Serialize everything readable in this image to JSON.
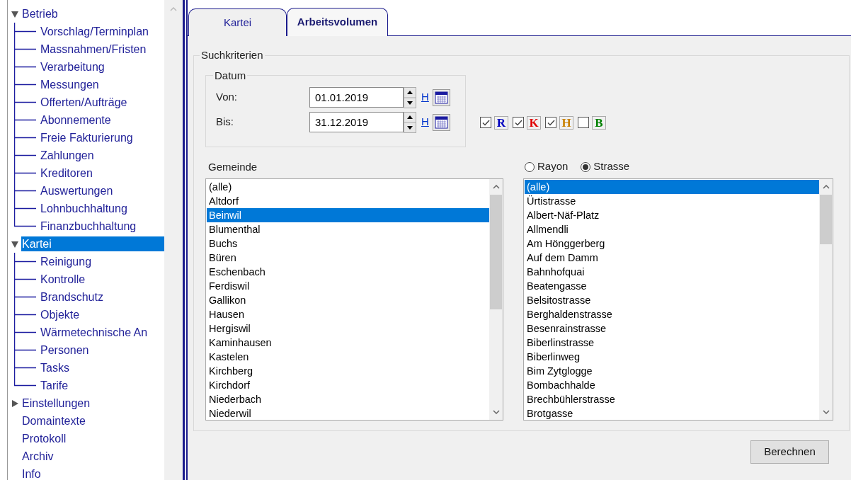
{
  "tree": [
    {
      "label": "Betrieb",
      "expanded": true,
      "selected": false,
      "children": [
        {
          "label": "Vorschlag/Terminplan",
          "selected": false
        },
        {
          "label": "Massnahmen/Fristen",
          "selected": false
        },
        {
          "label": "Verarbeitung",
          "selected": false
        },
        {
          "label": "Messungen",
          "selected": false
        },
        {
          "label": "Offerten/Aufträge",
          "selected": false
        },
        {
          "label": "Abonnemente",
          "selected": false
        },
        {
          "label": "Freie Fakturierung",
          "selected": false
        },
        {
          "label": "Zahlungen",
          "selected": false
        },
        {
          "label": "Kreditoren",
          "selected": false
        },
        {
          "label": "Auswertungen",
          "selected": false
        },
        {
          "label": "Lohnbuchhaltung",
          "selected": false
        },
        {
          "label": "Finanzbuchhaltung",
          "selected": false
        }
      ]
    },
    {
      "label": "Kartei",
      "expanded": true,
      "selected": true,
      "children": [
        {
          "label": "Reinigung",
          "selected": false
        },
        {
          "label": "Kontrolle",
          "selected": false
        },
        {
          "label": "Brandschutz",
          "selected": false
        },
        {
          "label": "Objekte",
          "selected": false
        },
        {
          "label": "Wärmetechnische An",
          "selected": false
        },
        {
          "label": "Personen",
          "selected": false
        },
        {
          "label": "Tasks",
          "selected": false
        },
        {
          "label": "Tarife",
          "selected": false
        }
      ]
    },
    {
      "label": "Einstellungen",
      "expanded": false,
      "selected": false
    },
    {
      "label": "Domaintexte",
      "selected": false
    },
    {
      "label": "Protokoll",
      "selected": false
    },
    {
      "label": "Archiv",
      "selected": false
    },
    {
      "label": "Info",
      "selected": false
    }
  ],
  "tabs": [
    {
      "label": "Kartei",
      "selected": false
    },
    {
      "label": "Arbeitsvolumen",
      "selected": true
    }
  ],
  "search_criteria": {
    "title": "Suchkriterien",
    "date": {
      "title": "Datum",
      "fields": [
        {
          "label": "Von:",
          "value": "01.01.2019",
          "link": "H"
        },
        {
          "label": "Bis:",
          "value": "31.12.2019",
          "link": "H"
        }
      ]
    },
    "filters": [
      {
        "letter": "R",
        "checked": true,
        "color": "#0000c0"
      },
      {
        "letter": "K",
        "checked": true,
        "color": "#e00000"
      },
      {
        "letter": "H",
        "checked": true,
        "color": "#c88000"
      },
      {
        "letter": "B",
        "checked": false,
        "color": "#008000"
      }
    ],
    "municipality": {
      "label": "Gemeinde",
      "items": [
        {
          "label": "(alle)",
          "selected": false
        },
        {
          "label": "Altdorf",
          "selected": false
        },
        {
          "label": "Beinwil",
          "selected": true
        },
        {
          "label": "Blumenthal",
          "selected": false
        },
        {
          "label": "Buchs",
          "selected": false
        },
        {
          "label": "Büren",
          "selected": false
        },
        {
          "label": "Eschenbach",
          "selected": false
        },
        {
          "label": "Ferdiswil",
          "selected": false
        },
        {
          "label": "Gallikon",
          "selected": false
        },
        {
          "label": "Hausen",
          "selected": false
        },
        {
          "label": "Hergiswil",
          "selected": false
        },
        {
          "label": "Kaminhausen",
          "selected": false
        },
        {
          "label": "Kastelen",
          "selected": false
        },
        {
          "label": "Kirchberg",
          "selected": false
        },
        {
          "label": "Kirchdorf",
          "selected": false
        },
        {
          "label": "Niederbach",
          "selected": false
        },
        {
          "label": "Niederwil",
          "selected": false
        }
      ]
    },
    "mode_options": [
      {
        "label": "Rayon",
        "selected": false
      },
      {
        "label": "Strasse",
        "selected": true
      }
    ],
    "streets": [
      {
        "label": "(alle)",
        "selected": true
      },
      {
        "label": "Ürtistrasse",
        "selected": false
      },
      {
        "label": "Albert-Näf-Platz",
        "selected": false
      },
      {
        "label": "Allmendli",
        "selected": false
      },
      {
        "label": "Am Hönggerberg",
        "selected": false
      },
      {
        "label": "Auf dem Damm",
        "selected": false
      },
      {
        "label": "Bahnhofquai",
        "selected": false
      },
      {
        "label": "Beatengasse",
        "selected": false
      },
      {
        "label": "Belsitostrasse",
        "selected": false
      },
      {
        "label": "Berghaldenstrasse",
        "selected": false
      },
      {
        "label": "Besenrainstrasse",
        "selected": false
      },
      {
        "label": "Biberlinstrasse",
        "selected": false
      },
      {
        "label": "Biberlinweg",
        "selected": false
      },
      {
        "label": "Bim Zytglogge",
        "selected": false
      },
      {
        "label": "Bombachhalde",
        "selected": false
      },
      {
        "label": "Brechbühlerstrasse",
        "selected": false
      },
      {
        "label": "Brotgasse",
        "selected": false
      }
    ]
  },
  "button": "Berechnen"
}
